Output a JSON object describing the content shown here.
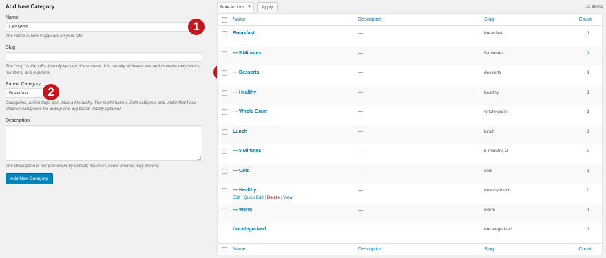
{
  "form": {
    "heading": "Add New Category",
    "name_label": "Name",
    "name_value": "Desserts",
    "name_help": "The name is how it appears on your site.",
    "slug_label": "Slug",
    "slug_value": "",
    "slug_help_1": "The “slug” is the URL-friendly version of the name. It is usually all lowercase and contains only letters,",
    "slug_help_2": "numbers, and hyphens.",
    "parent_label": "Parent Category",
    "parent_value": "Breakfast",
    "parent_help_1": "Categories, unlike tags, can have a hierarchy. You might have a Jazz category, and under that have",
    "parent_help_2": "children categories for Bebop and Big Band. Totally optional.",
    "description_label": "Description",
    "description_value": "",
    "description_help": "The description is not prominent by default; however, some themes may show it.",
    "submit_label": "Add New Category"
  },
  "markers": [
    "1",
    "2",
    "3"
  ],
  "toolbar": {
    "bulk_actions": "Bulk Actions",
    "apply_label": "Apply",
    "items_count": "11 items"
  },
  "columns": {
    "name": "Name",
    "description": "Description",
    "slug": "Slug",
    "count": "Count"
  },
  "rows": [
    {
      "name": "Breakfast",
      "description": "—",
      "slug": "breakfast",
      "count": "1"
    },
    {
      "name": "— 5 Minutes",
      "description": "—",
      "slug": "5-minutes",
      "count": "1"
    },
    {
      "name": "— Desserts",
      "description": "—",
      "slug": "desserts",
      "count": "1"
    },
    {
      "name": "— Healthy",
      "description": "—",
      "slug": "healthy",
      "count": "1"
    },
    {
      "name": "— Whole Grain",
      "description": "—",
      "slug": "whole-grain",
      "count": "1"
    },
    {
      "name": "Lunch",
      "description": "—",
      "slug": "lunch",
      "count": "1"
    },
    {
      "name": "— 5 Minutes",
      "description": "—",
      "slug": "5-minutes-2",
      "count": "0"
    },
    {
      "name": "— Cold",
      "description": "—",
      "slug": "cold",
      "count": "1"
    },
    {
      "name": "— Healthy",
      "description": "—",
      "slug": "healthy-lunch",
      "count": "0"
    },
    {
      "name": "— Warm",
      "description": "—",
      "slug": "warm",
      "count": "1"
    },
    {
      "name": "Uncategorized",
      "description": "",
      "slug": "uncategorized",
      "count": "1"
    }
  ],
  "row_actions": {
    "edit": "Edit",
    "quick_edit": "Quick Edit",
    "delete": "Delete",
    "view": "View"
  },
  "colors": {
    "link": "#0073aa",
    "primary_button": "#0085ba",
    "marker": "#c8161d",
    "delete": "#aa0000"
  }
}
